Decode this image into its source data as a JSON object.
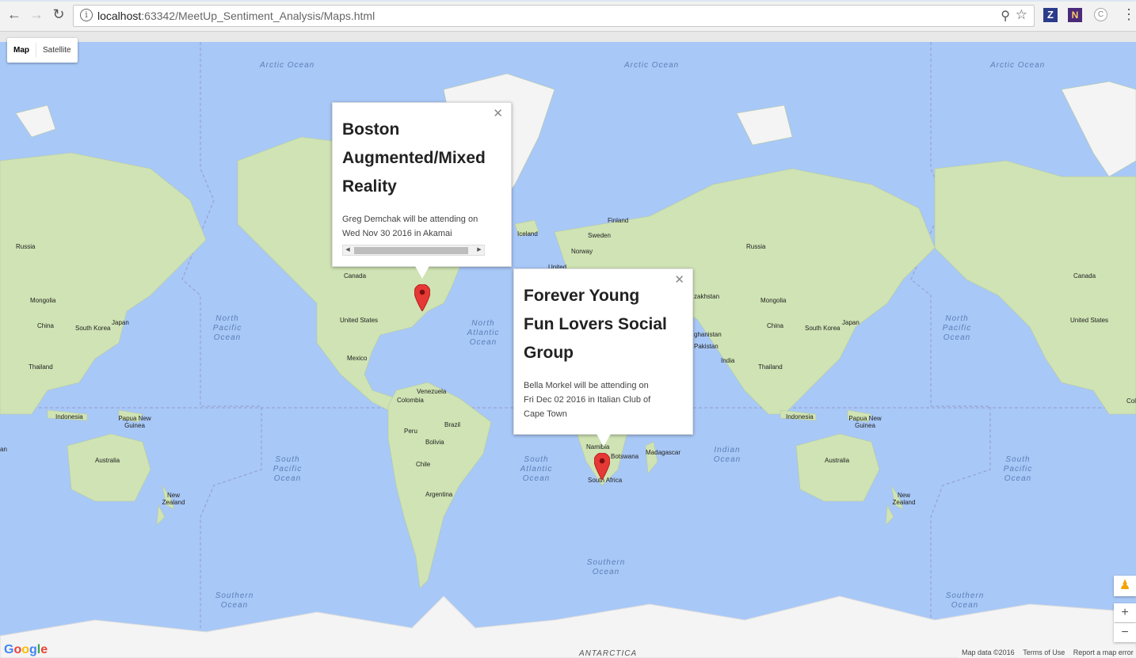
{
  "browser": {
    "url_host": "localhost",
    "url_path": ":63342/MeetUp_Sentiment_Analysis/Maps.html",
    "extensions": [
      "Z",
      "N",
      "C"
    ]
  },
  "map_type": {
    "map_label": "Map",
    "satellite_label": "Satellite",
    "selected": "Map"
  },
  "oceans": {
    "arctic": "Arctic Ocean",
    "north_pacific": "North Pacific Ocean",
    "north_atlantic": "North Atlantic Ocean",
    "south_pacific": "South Pacific Ocean",
    "south_atlantic": "South Atlantic Ocean",
    "indian": "Indian Ocean",
    "southern": "Southern Ocean",
    "antarctica": "ANTARCTICA"
  },
  "places": {
    "russia": "Russia",
    "mongolia": "Mongolia",
    "china": "China",
    "south_korea": "South Korea",
    "japan": "Japan",
    "thailand": "Thailand",
    "indonesia": "Indonesia",
    "papua": "Papua New Guinea",
    "australia": "Australia",
    "new_zealand": "New Zealand",
    "canada": "Canada",
    "united_states": "United States",
    "mexico": "Mexico",
    "venezuela": "Venezuela",
    "colombia": "Colombia",
    "peru": "Peru",
    "brazil": "Brazil",
    "bolivia": "Bolivia",
    "chile": "Chile",
    "argentina": "Argentina",
    "iceland": "Iceland",
    "finland": "Finland",
    "sweden": "Sweden",
    "norway": "Norway",
    "united": "United",
    "kazakhstan": "zakhstan",
    "afghanistan": "ghanistan",
    "pakistan": "Pakistan",
    "india": "India",
    "namibia": "Namibia",
    "botswana": "Botswana",
    "madagascar": "Madagascar",
    "south_africa": "South Africa",
    "an": "an",
    "colo": "Colo",
    "greenland": ""
  },
  "info_windows": [
    {
      "title": "Boston Augmented/Mixed Reality",
      "title_lines": [
        "Boston",
        "Augmented/Mixed",
        "Reality"
      ],
      "body_lines": [
        "Greg Demchak will be attending on",
        "Wed Nov 30 2016 in Akamai"
      ]
    },
    {
      "title": "Forever Young Fun Lovers Social Group",
      "title_lines": [
        "Forever Young",
        "Fun Lovers Social",
        "Group"
      ],
      "body_lines": [
        "Bella Morkel will be attending on",
        "Fri Dec 02 2016 in Italian Club of",
        "Cape Town"
      ]
    }
  ],
  "controls": {
    "zoom_in": "+",
    "zoom_out": "−",
    "pegman": "♟"
  },
  "footer": {
    "map_data": "Map data ©2016",
    "terms": "Terms of Use",
    "report": "Report a map error"
  },
  "logo": "Google",
  "colors": {
    "ocean": "#a8c8f7",
    "land": "#cfe3b4",
    "ice": "#f4f4f4",
    "pin": "#e53935"
  }
}
